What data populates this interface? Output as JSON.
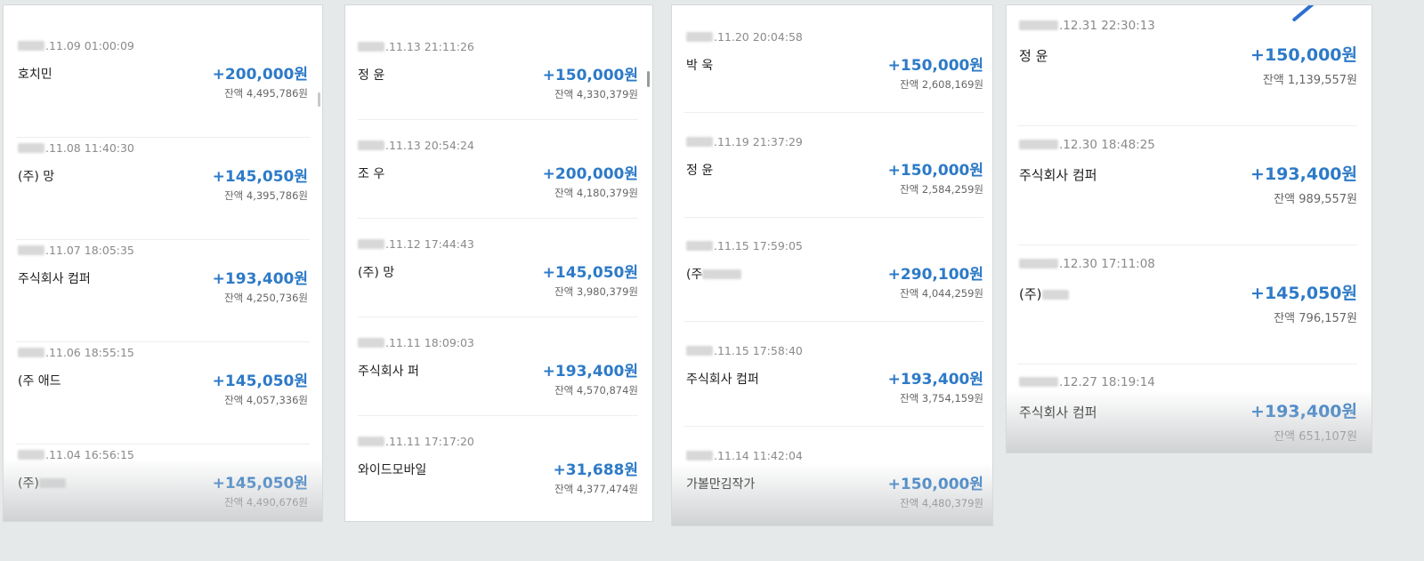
{
  "panels": [
    {
      "transactions": [
        {
          "date": ".11.09",
          "time": "01:00:09",
          "name": "호치민",
          "amount": "+200,000원",
          "balance": "잔액 4,495,786원"
        },
        {
          "date": ".11.08",
          "time": "11:40:30",
          "name": "(주)  망",
          "amount": "+145,050원",
          "balance": "잔액 4,395,786원"
        },
        {
          "date": ".11.07",
          "time": "18:05:35",
          "name": "주식회사        컴퍼",
          "amount": "+193,400원",
          "balance": "잔액 4,250,736원"
        },
        {
          "date": ".11.06",
          "time": "18:55:15",
          "name": "(주        애드",
          "amount": "+145,050원",
          "balance": "잔액 4,057,336원"
        },
        {
          "date": ".11.04",
          "time": "16:56:15",
          "name": "(주)",
          "amount": "+145,050원",
          "balance": "잔액 4,490,676원"
        }
      ]
    },
    {
      "transactions": [
        {
          "date": ".11.13",
          "time": "21:11:26",
          "name": "정  윤",
          "amount": "+150,000원",
          "balance": "잔액 4,330,379원"
        },
        {
          "date": ".11.13",
          "time": "20:54:24",
          "name": "조  우",
          "amount": "+200,000원",
          "balance": "잔액 4,180,379원"
        },
        {
          "date": ".11.12",
          "time": "17:44:43",
          "name": "(주)  망",
          "amount": "+145,050원",
          "balance": "잔액 3,980,379원"
        },
        {
          "date": ".11.11",
          "time": "18:09:03",
          "name": "주식회사        퍼",
          "amount": "+193,400원",
          "balance": "잔액 4,570,874원"
        },
        {
          "date": ".11.11",
          "time": "17:17:20",
          "name": "와이드모바일",
          "amount": "+31,688원",
          "balance": "잔액 4,377,474원"
        }
      ]
    },
    {
      "transactions": [
        {
          "date": ".11.20",
          "time": "20:04:58",
          "name": "박  욱",
          "amount": "+150,000원",
          "balance": "잔액 2,608,169원"
        },
        {
          "date": ".11.19",
          "time": "21:37:29",
          "name": "정  윤",
          "amount": "+150,000원",
          "balance": "잔액 2,584,259원"
        },
        {
          "date": ".11.15",
          "time": "17:59:05",
          "name": "(주",
          "amount": "+290,100원",
          "balance": "잔액 4,044,259원"
        },
        {
          "date": ".11.15",
          "time": "17:58:40",
          "name": "주식회사        컴퍼",
          "amount": "+193,400원",
          "balance": "잔액 3,754,159원"
        },
        {
          "date": ".11.14",
          "time": "11:42:04",
          "name": "가볼만김작가",
          "amount": "+150,000원",
          "balance": "잔액 4,480,379원"
        }
      ]
    },
    {
      "transactions": [
        {
          "date": ".12.31",
          "time": "22:30:13",
          "name": "정  윤",
          "amount": "+150,000원",
          "balance": "잔액 1,139,557원"
        },
        {
          "date": ".12.30",
          "time": "18:48:25",
          "name": "주식회사        컴퍼",
          "amount": "+193,400원",
          "balance": "잔액 989,557원"
        },
        {
          "date": ".12.30",
          "time": "17:11:08",
          "name": "(주)",
          "amount": "+145,050원",
          "balance": "잔액 796,157원"
        },
        {
          "date": ".12.27",
          "time": "18:19:14",
          "name": "주식회사        컴퍼",
          "amount": "+193,400원",
          "balance": "잔액 651,107원"
        }
      ]
    }
  ],
  "colors": {
    "amount": "#2d7ac7",
    "background": "#e6e9ea",
    "panel": "#ffffff",
    "pen": "#2e6fd0"
  }
}
